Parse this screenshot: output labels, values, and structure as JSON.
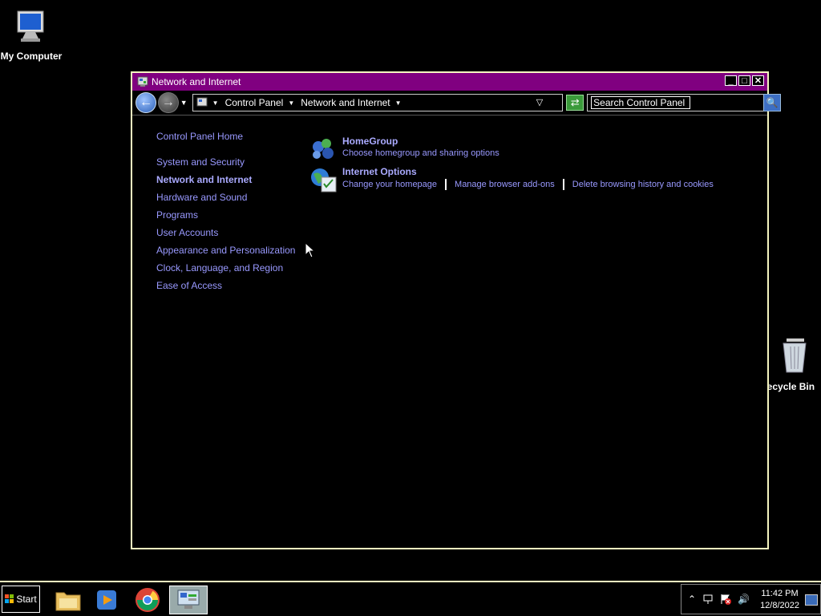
{
  "desktop": {
    "my_computer": "My Computer",
    "recycle_bin": "Recycle Bin"
  },
  "window": {
    "title": "Network and Internet",
    "address": {
      "segments": [
        "Control Panel",
        "Network and Internet"
      ]
    },
    "search_placeholder": "Search Control Panel"
  },
  "leftnav": {
    "home": "Control Panel Home",
    "items": [
      "System and Security",
      "Network and Internet",
      "Hardware and Sound",
      "Programs",
      "User Accounts",
      "Appearance and Personalization",
      "Clock, Language, and Region",
      "Ease of Access"
    ]
  },
  "content": {
    "homegroup": {
      "title": "HomeGroup",
      "links": [
        "Choose homegroup and sharing options"
      ]
    },
    "internet_options": {
      "title": "Internet Options",
      "links": [
        "Change your homepage",
        "Manage browser add-ons",
        "Delete browsing history and cookies"
      ]
    }
  },
  "taskbar": {
    "start": "Start",
    "time": "11:42 PM",
    "date": "12/8/2022"
  },
  "colors": {
    "titlebar": "#800080",
    "link": "#9999ff",
    "window_border": "#f5f5c0"
  }
}
